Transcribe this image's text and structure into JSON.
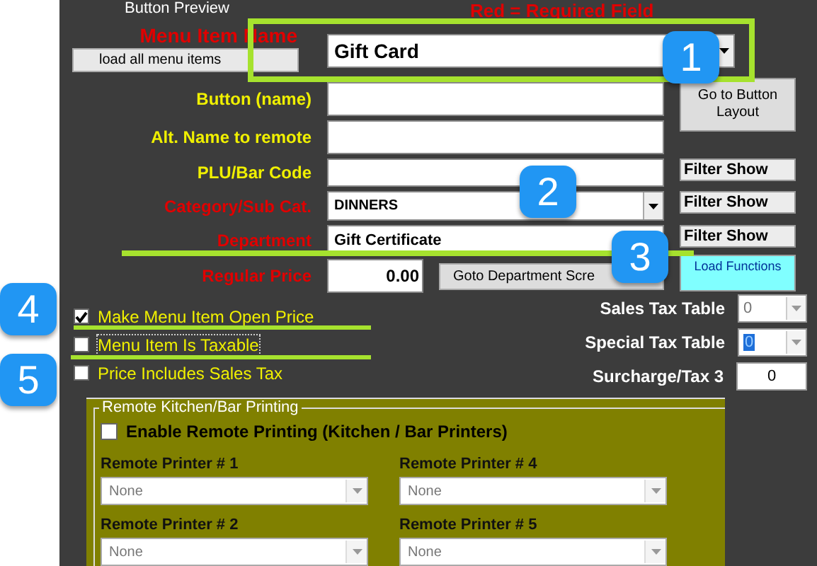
{
  "header": {
    "preview_label": "Button Preview",
    "legend": "Red = Required Field"
  },
  "load_button": "load all menu items",
  "fields": [
    {
      "label": "Menu Item Name",
      "required": true,
      "kind": "combo",
      "value": "Gift Card"
    },
    {
      "label": "Button (name)",
      "required": false,
      "kind": "text",
      "side": {
        "kind": "tall",
        "label": "Go to Button Layout"
      }
    },
    {
      "label": "Alt. Name to remote",
      "required": false,
      "kind": "text"
    },
    {
      "label": "PLU/Bar Code",
      "required": false,
      "kind": "text",
      "side": {
        "kind": "filter",
        "label": "Filter Show"
      }
    },
    {
      "label": "Category/Sub Cat.",
      "required": true,
      "kind": "combo",
      "value": "DINNERS",
      "side": {
        "kind": "filter",
        "label": "Filter Show"
      }
    },
    {
      "label": "Department",
      "required": true,
      "kind": "text",
      "value": "Gift Certificate",
      "side": {
        "kind": "filter",
        "label": "Filter Show"
      }
    },
    {
      "label": "Regular Price",
      "required": true,
      "kind": "price",
      "value": "0.00",
      "button": "Goto Department Scre",
      "side": {
        "kind": "cyan",
        "label": "Load Functions"
      }
    }
  ],
  "checkboxes": [
    {
      "label": "Make Menu Item Open Price",
      "checked": true,
      "focused": false
    },
    {
      "label": "Menu Item Is Taxable",
      "checked": false,
      "focused": true
    },
    {
      "label": "Price Includes Sales Tax",
      "checked": false,
      "focused": false
    }
  ],
  "tax": [
    {
      "label": "Sales Tax Table",
      "kind": "combo",
      "value": "0",
      "selected": false
    },
    {
      "label": "Special Tax Table",
      "kind": "combo",
      "value": "0",
      "selected": true
    },
    {
      "label": "Surcharge/Tax 3",
      "kind": "text",
      "value": "0"
    }
  ],
  "remote_printing": {
    "legend": "Remote Kitchen/Bar Printing",
    "enable_label": "Enable Remote Printing (Kitchen / Bar Printers)",
    "enabled": false,
    "printers": [
      {
        "label": "Remote Printer # 1",
        "value": "None"
      },
      {
        "label": "Remote Printer # 4",
        "value": "None"
      },
      {
        "label": "Remote Printer # 2",
        "value": "None"
      },
      {
        "label": "Remote Printer # 5",
        "value": "None"
      }
    ]
  },
  "callouts": [
    "1",
    "2",
    "3",
    "4",
    "5"
  ]
}
